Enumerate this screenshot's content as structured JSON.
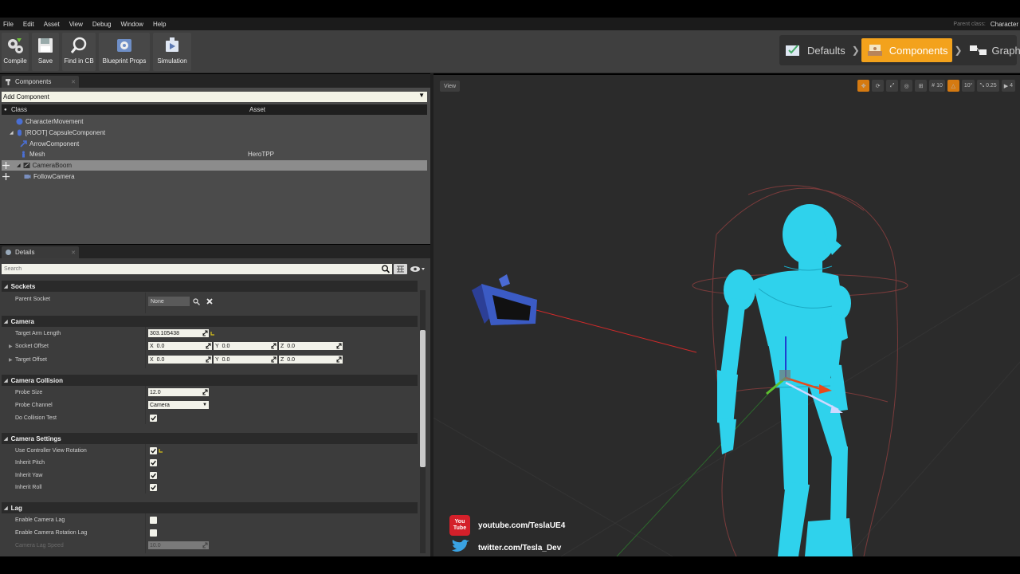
{
  "menu": [
    "File",
    "Edit",
    "Asset",
    "View",
    "Debug",
    "Window",
    "Help"
  ],
  "parent_class": {
    "label": "Parent class:",
    "value": "Character"
  },
  "toolbar": [
    {
      "label": "Compile",
      "icon": "compile-gear-icon"
    },
    {
      "label": "Save",
      "icon": "save-disk-icon"
    },
    {
      "label": "Find in CB",
      "icon": "magnifier-icon"
    },
    {
      "label": "Blueprint Props",
      "icon": "blueprint-gear-icon"
    },
    {
      "label": "Simulation",
      "icon": "simulation-icon"
    }
  ],
  "modes": [
    {
      "label": "Defaults",
      "icon": "defaults-icon",
      "active": false
    },
    {
      "label": "Components",
      "icon": "components-icon",
      "active": true
    },
    {
      "label": "Graph",
      "icon": "graph-icon",
      "active": false
    }
  ],
  "components_panel": {
    "tab": "Components",
    "add_component": "Add Component",
    "columns": [
      "Class",
      "Asset"
    ],
    "tree": [
      {
        "name": "CharacterMovement",
        "asset": "",
        "selected": false
      },
      {
        "name": "[ROOT] CapsuleComponent",
        "asset": "",
        "selected": false
      },
      {
        "name": "ArrowComponent",
        "asset": "",
        "selected": false
      },
      {
        "name": "Mesh",
        "asset": "HeroTPP",
        "selected": false
      },
      {
        "name": "CameraBoom",
        "asset": "",
        "selected": true
      },
      {
        "name": "FollowCamera",
        "asset": "",
        "selected": false
      }
    ]
  },
  "details_panel": {
    "tab": "Details",
    "search_placeholder": "Search",
    "sockets": {
      "title": "Sockets",
      "parent_socket_label": "Parent Socket",
      "parent_socket_value": "None"
    },
    "camera": {
      "title": "Camera",
      "target_arm_length_label": "Target Arm Length",
      "target_arm_length": "303.105438",
      "socket_offset_label": "Socket Offset",
      "socket_offset": {
        "x": "0.0",
        "y": "0.0",
        "z": "0.0"
      },
      "target_offset_label": "Target Offset",
      "target_offset": {
        "x": "0.0",
        "y": "0.0",
        "z": "0.0"
      },
      "axis_x": "X",
      "axis_y": "Y",
      "axis_z": "Z"
    },
    "camera_collision": {
      "title": "Camera Collision",
      "probe_size_label": "Probe Size",
      "probe_size": "12.0",
      "probe_channel_label": "Probe Channel",
      "probe_channel": "Camera",
      "do_collision_test_label": "Do Collision Test",
      "do_collision_test": true
    },
    "camera_settings": {
      "title": "Camera Settings",
      "use_controller_view_rotation_label": "Use Controller View Rotation",
      "use_controller_view_rotation": true,
      "inherit_pitch_label": "Inherit Pitch",
      "inherit_pitch": true,
      "inherit_yaw_label": "Inherit Yaw",
      "inherit_yaw": true,
      "inherit_roll_label": "Inherit Roll",
      "inherit_roll": true
    },
    "lag": {
      "title": "Lag",
      "enable_camera_lag_label": "Enable Camera Lag",
      "enable_camera_lag": false,
      "enable_camera_rotation_lag_label": "Enable Camera Rotation Lag",
      "enable_camera_rotation_lag": false,
      "camera_lag_speed_label": "Camera Lag Speed",
      "camera_lag_speed": "10.0"
    }
  },
  "viewport": {
    "view_button": "View",
    "tools": [
      {
        "label": "",
        "icon": "translate-icon",
        "on": true
      },
      {
        "label": "",
        "icon": "rotate-icon",
        "on": false
      },
      {
        "label": "",
        "icon": "scale-icon",
        "on": false
      },
      {
        "label": "",
        "icon": "world-icon",
        "on": false
      },
      {
        "label": "",
        "icon": "surface-snap-icon",
        "on": false
      },
      {
        "label": "10",
        "icon": "grid-snap-icon",
        "on": false
      },
      {
        "label": "",
        "icon": "rotation-snap-icon",
        "on": true
      },
      {
        "label": "10°",
        "icon": "rotation-snap-value",
        "on": false
      },
      {
        "label": "0.25",
        "icon": "scale-snap-icon",
        "on": false
      },
      {
        "label": "4",
        "icon": "camera-speed-icon",
        "on": false
      }
    ]
  },
  "overlay": {
    "youtube": "youtube.com/TeslaUE4",
    "youtube_logo_line1": "You",
    "youtube_logo_line2": "Tube",
    "twitter": "twitter.com/Tesla_Dev"
  },
  "colors": {
    "accent_orange": "#f3a21c",
    "character_cyan": "#2fd2ec",
    "camera_blue": "#3b5bc4"
  }
}
